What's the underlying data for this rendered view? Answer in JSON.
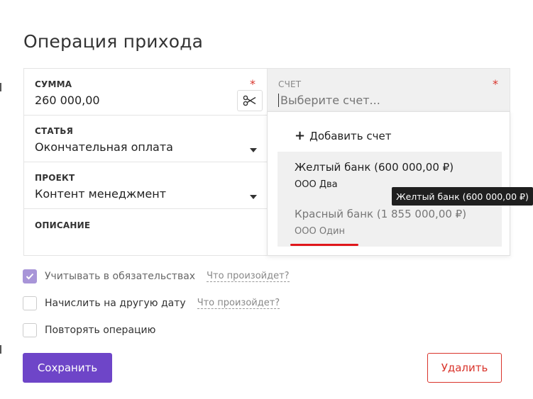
{
  "page": {
    "title": "Операция прихода"
  },
  "form": {
    "amount": {
      "label": "СУММА",
      "value": "260 000,00",
      "required": "*"
    },
    "account": {
      "label": "СЧЕТ",
      "placeholder": "Выберите счет...",
      "required": "*"
    },
    "category": {
      "label": "СТАТЬЯ",
      "value": "Окончательная оплата"
    },
    "project": {
      "label": "ПРОЕКТ",
      "value": "Контент менеджмент"
    },
    "description": {
      "label": "ОПИСАНИЕ",
      "value": ""
    }
  },
  "dropdown": {
    "add_label": "Добавить счет",
    "options": [
      {
        "name": "Желтый банк (600 000,00 ₽)",
        "company": "ООО Два"
      },
      {
        "name": "Красный банк (1 855 000,00 ₽)",
        "company": "ООО Один"
      }
    ]
  },
  "tooltip": {
    "text": "Желтый банк (600 000,00 ₽)"
  },
  "checkboxes": [
    {
      "label": "Учитывать в обязательствах",
      "hint": "Что произойдет?",
      "checked": true
    },
    {
      "label": "Начислить на другую дату",
      "hint": "Что произойдет?",
      "checked": false
    },
    {
      "label": "Повторять операцию",
      "checked": false
    }
  ],
  "actions": {
    "save_label": "Сохранить",
    "delete_label": "Удалить"
  },
  "colors": {
    "primary": "#6e45c8",
    "danger": "#d9342b",
    "checkbox_checked": "#a895d8",
    "tooltip_bg": "#1f1f1f"
  },
  "icons": {
    "amount_action": "scissors-icon",
    "add": "plus-icon",
    "dropdown": "caret-down-icon",
    "checked": "checkmark-icon"
  }
}
